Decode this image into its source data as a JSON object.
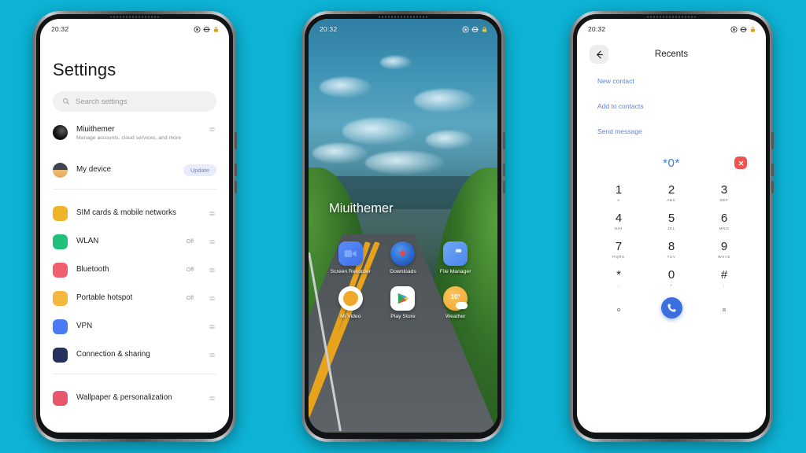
{
  "background_color": "#0db2d4",
  "status_bar": {
    "time": "20:32",
    "icons": [
      "location-icon",
      "vpn-icon",
      "lock-icon"
    ]
  },
  "phone_settings": {
    "title": "Settings",
    "search": {
      "placeholder": "Search settings",
      "icon": "search-icon"
    },
    "account": {
      "name": "Miuithemer",
      "subtitle": "Manage accounts, cloud services, and more"
    },
    "device": {
      "label": "My device",
      "badge": "Update"
    },
    "items": [
      {
        "label": "SIM cards & mobile networks",
        "state": "",
        "icon_color": "#f0b429"
      },
      {
        "label": "WLAN",
        "state": "Off",
        "icon_color": "#1fc17a"
      },
      {
        "label": "Bluetooth",
        "state": "Off",
        "icon_color": "#ef5f6e"
      },
      {
        "label": "Portable hotspot",
        "state": "Off",
        "icon_color": "#f4b740"
      },
      {
        "label": "VPN",
        "state": "",
        "icon_color": "#4a7bf7"
      },
      {
        "label": "Connection & sharing",
        "state": "",
        "icon_color": "#26305c"
      }
    ],
    "items_group2": [
      {
        "label": "Wallpaper & personalization",
        "state": "",
        "icon_color": "#e9556d"
      }
    ]
  },
  "phone_home": {
    "greeting": "Miuithemer",
    "apps_row1": [
      {
        "name": "Screen Recorder",
        "icon": "video-camera-icon"
      },
      {
        "name": "Downloads",
        "icon": "download-arrow-icon"
      },
      {
        "name": "File Manager",
        "icon": "folder-icon"
      }
    ],
    "apps_row2": [
      {
        "name": "Mi Video",
        "icon": "play-blob-icon"
      },
      {
        "name": "Play Store",
        "icon": "play-store-icon"
      },
      {
        "name": "Weather",
        "icon": "sun-cloud-icon",
        "temperature": "10°"
      }
    ]
  },
  "phone_dialer": {
    "title": "Recents",
    "back_icon": "arrow-left-icon",
    "links": [
      "New contact",
      "Add to contacts",
      "Send message"
    ],
    "number": "*0*",
    "clear_icon": "close-x-icon",
    "call_icon": "phone-call-icon",
    "keys": [
      {
        "digit": "1",
        "sub": "∞"
      },
      {
        "digit": "2",
        "sub": "ABC"
      },
      {
        "digit": "3",
        "sub": "DEF"
      },
      {
        "digit": "4",
        "sub": "GHI"
      },
      {
        "digit": "5",
        "sub": "JKL"
      },
      {
        "digit": "6",
        "sub": "MNO"
      },
      {
        "digit": "7",
        "sub": "PQRS"
      },
      {
        "digit": "8",
        "sub": "TUV"
      },
      {
        "digit": "9",
        "sub": "WXYZ"
      },
      {
        "digit": "*",
        "sub": ","
      },
      {
        "digit": "0",
        "sub": "+"
      },
      {
        "digit": "#",
        "sub": ";"
      }
    ]
  }
}
